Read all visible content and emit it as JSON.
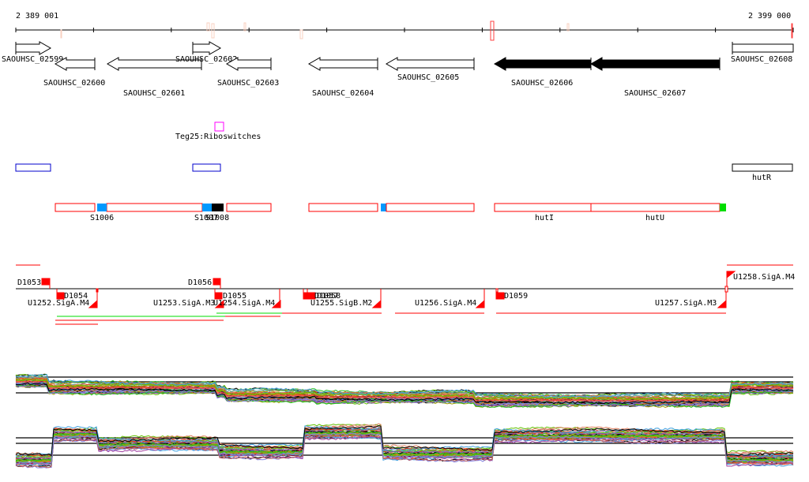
{
  "ruler": {
    "start_label": "2 389 001",
    "end_label": "2 399 000"
  },
  "genes": [
    {
      "label": "SAOUHSC_02599",
      "strand": "+",
      "filled": false
    },
    {
      "label": "SAOUHSC_02600",
      "strand": "-",
      "filled": false
    },
    {
      "label": "SAOUHSC_02601",
      "strand": "-",
      "filled": false
    },
    {
      "label": "SAOUHSC_02602",
      "strand": "+",
      "filled": false
    },
    {
      "label": "SAOUHSC_02603",
      "strand": "-",
      "filled": false
    },
    {
      "label": "SAOUHSC_02604",
      "strand": "-",
      "filled": false
    },
    {
      "label": "SAOUHSC_02605",
      "strand": "-",
      "filled": false
    },
    {
      "label": "SAOUHSC_02606",
      "strand": "-",
      "filled": true
    },
    {
      "label": "SAOUHSC_02607",
      "strand": "-",
      "filled": true
    },
    {
      "label": "SAOUHSC_02608",
      "strand": "+",
      "filled": false
    }
  ],
  "riboswitch": {
    "label": "Teg25:Riboswitches",
    "color": "#ff00ff"
  },
  "regulators": {
    "label": "hutR",
    "color": "#0000cc"
  },
  "operons": {
    "labels": [
      "S1006",
      "S1007",
      "S1008",
      "hutI",
      "hutU"
    ],
    "color": "#ff0000",
    "accent_blue": "#0099ff",
    "accent_green": "#00dd00"
  },
  "promoters": {
    "labels": [
      "D1053",
      "D1054",
      "U1252.SigA.M4",
      "D1056",
      "D1055",
      "U1253.SigA.M3",
      "U1254.SigA.M4",
      "D1057",
      "D1058",
      "U1255.SigB.M2",
      "U1256.SigA.M4",
      "D1059",
      "U1257.SigA.M3",
      "U1258.SigA.M4"
    ],
    "color": "#ff0000"
  },
  "signal_tracks": {
    "count": 2,
    "line_count": 40
  }
}
